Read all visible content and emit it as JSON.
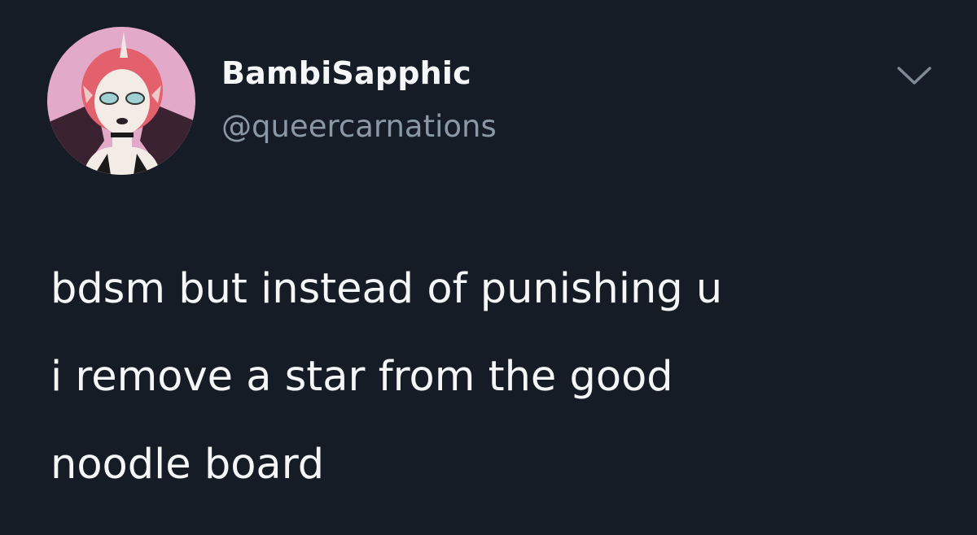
{
  "author": {
    "display_name": "BambiSapphic",
    "handle": "@queercarnations",
    "avatar_icon": "illustrated-avatar"
  },
  "menu": {
    "icon": "chevron-down-icon"
  },
  "tweet": {
    "lines": [
      "bdsm but instead of punishing u",
      "i remove a star from the good",
      "noodle board"
    ]
  },
  "colors": {
    "background": "#151c25",
    "text": "#f4f6f8",
    "secondary_text": "#8b98a5"
  }
}
